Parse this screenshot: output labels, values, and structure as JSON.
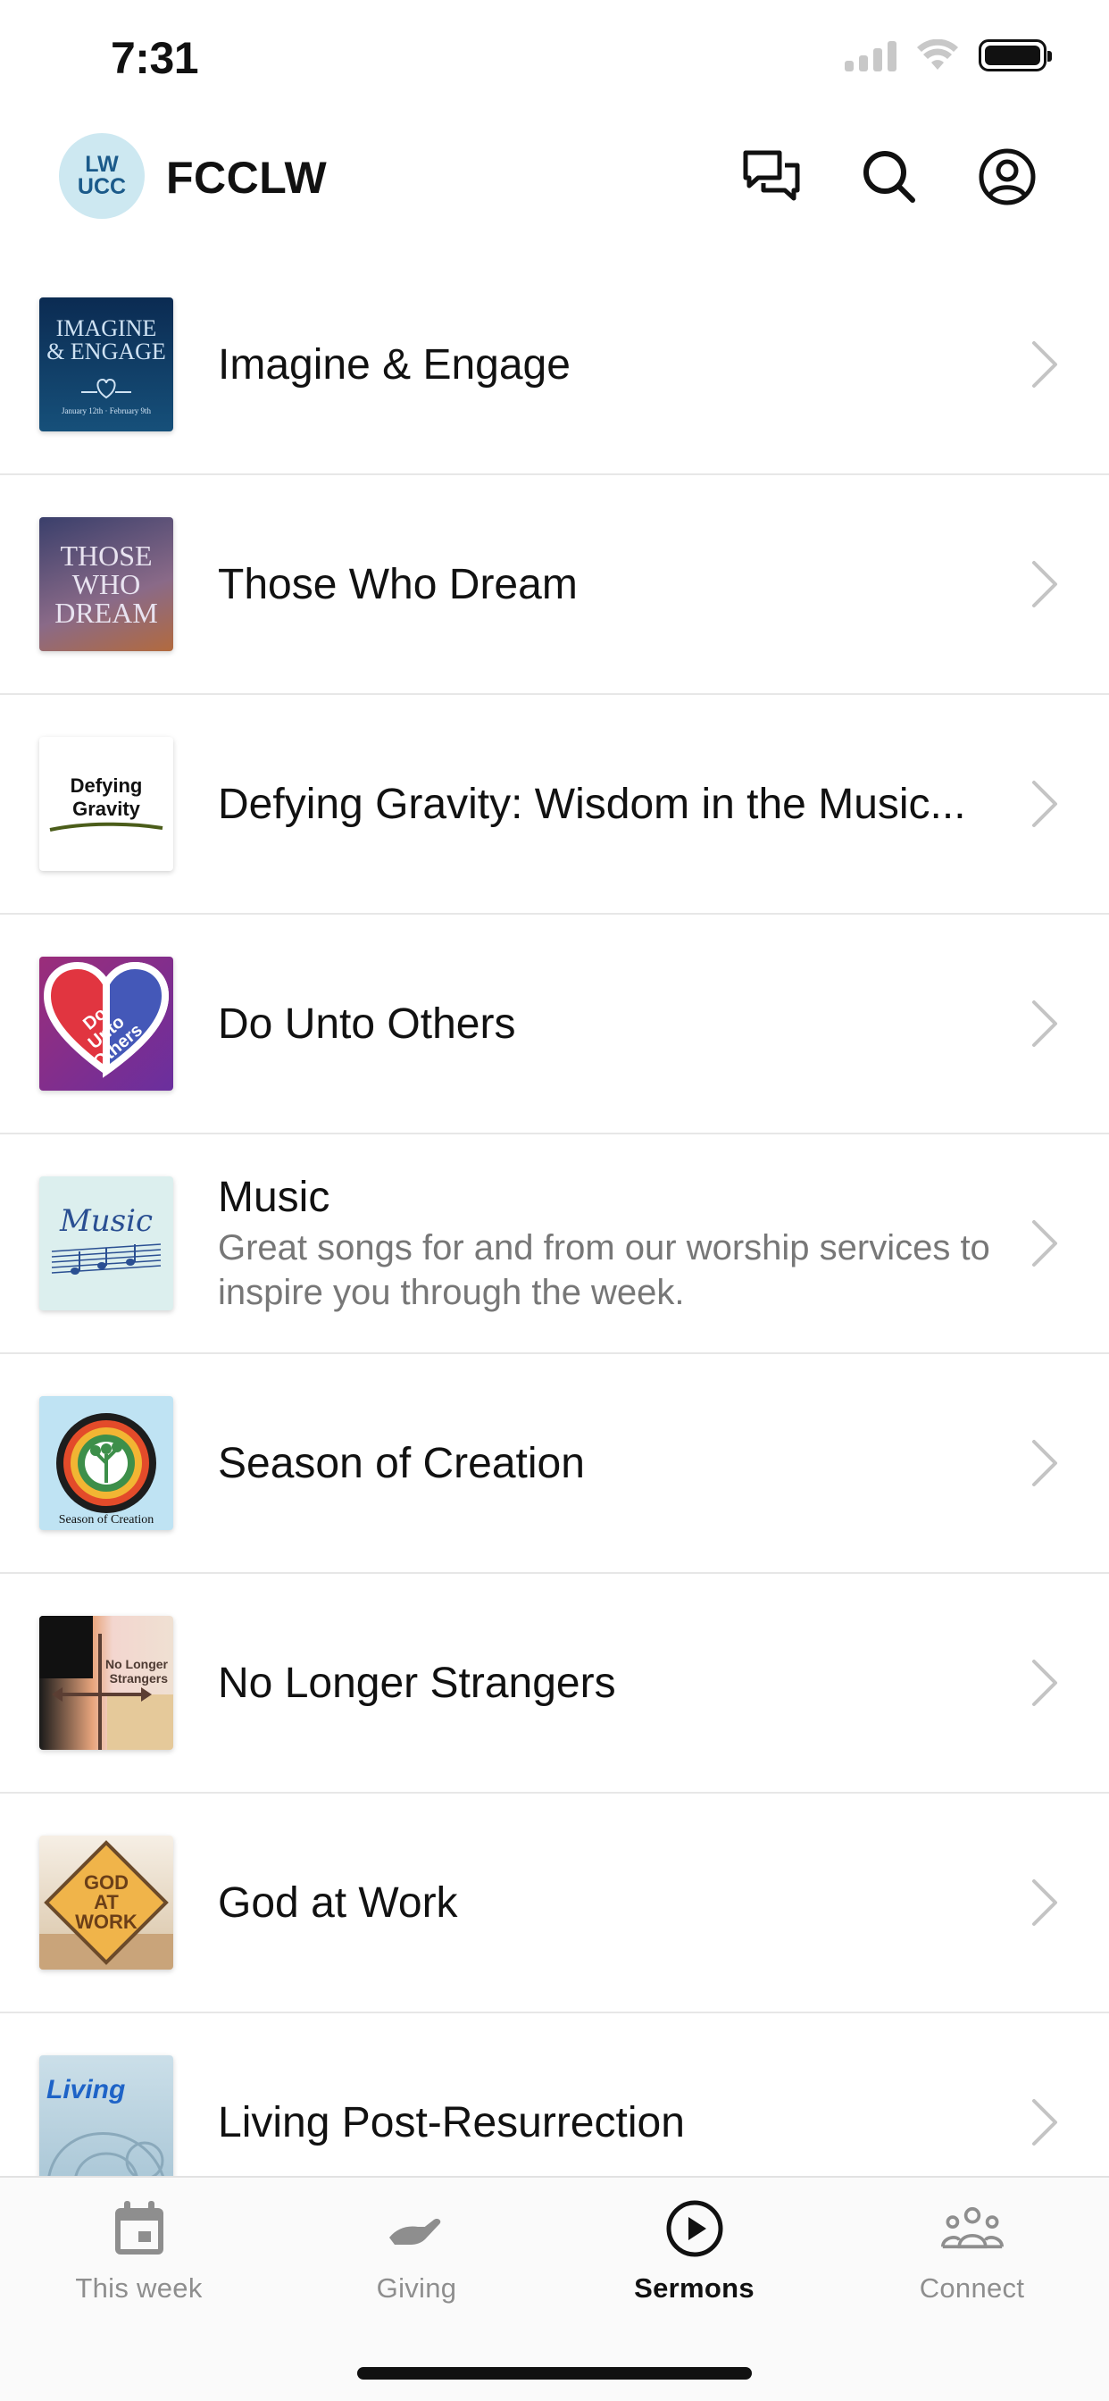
{
  "status_bar": {
    "time": "7:31"
  },
  "header": {
    "logo_text_top": "LW",
    "logo_text_bottom": "UCC",
    "title": "FCCLW",
    "icons": [
      "chat-icon",
      "search-icon",
      "profile-icon"
    ]
  },
  "sermon_series": [
    {
      "title": "Imagine & Engage",
      "subtitle": "",
      "thumb_text": [
        "IMAGINE",
        "& ENGAGE"
      ],
      "thumb_caption": "January 12th · February 9th"
    },
    {
      "title": "Those Who Dream",
      "subtitle": "",
      "thumb_text": [
        "THOSE",
        "WHO",
        "DREAM"
      ]
    },
    {
      "title": "Defying Gravity: Wisdom in the Music...",
      "subtitle": "",
      "thumb_text": [
        "Defying Gravity"
      ]
    },
    {
      "title": "Do Unto Others",
      "subtitle": "",
      "thumb_text": [
        "Do",
        "Unto",
        "Others"
      ]
    },
    {
      "title": "Music",
      "subtitle": "Great songs for and from our worship services to inspire you through the week.",
      "thumb_text": [
        "Music"
      ]
    },
    {
      "title": "Season of Creation",
      "subtitle": "",
      "thumb_text": [
        "Season of Creation"
      ]
    },
    {
      "title": "No Longer Strangers",
      "subtitle": "",
      "thumb_text": [
        "No Longer",
        "Strangers"
      ]
    },
    {
      "title": "God at Work",
      "subtitle": "",
      "thumb_text": [
        "GOD",
        "AT",
        "WORK"
      ]
    },
    {
      "title": "Living Post-Resurrection",
      "subtitle": "",
      "thumb_text": [
        "Living"
      ]
    }
  ],
  "tab_bar": {
    "tabs": [
      {
        "label": "This week",
        "icon": "calendar-icon",
        "active": false
      },
      {
        "label": "Giving",
        "icon": "giving-hand-icon",
        "active": false
      },
      {
        "label": "Sermons",
        "icon": "play-circle-icon",
        "active": true
      },
      {
        "label": "Connect",
        "icon": "people-group-icon",
        "active": false
      }
    ]
  },
  "colors": {
    "accent": "#111111",
    "inactive_tab": "#8e8e8e",
    "divider": "#e7e7e7"
  }
}
